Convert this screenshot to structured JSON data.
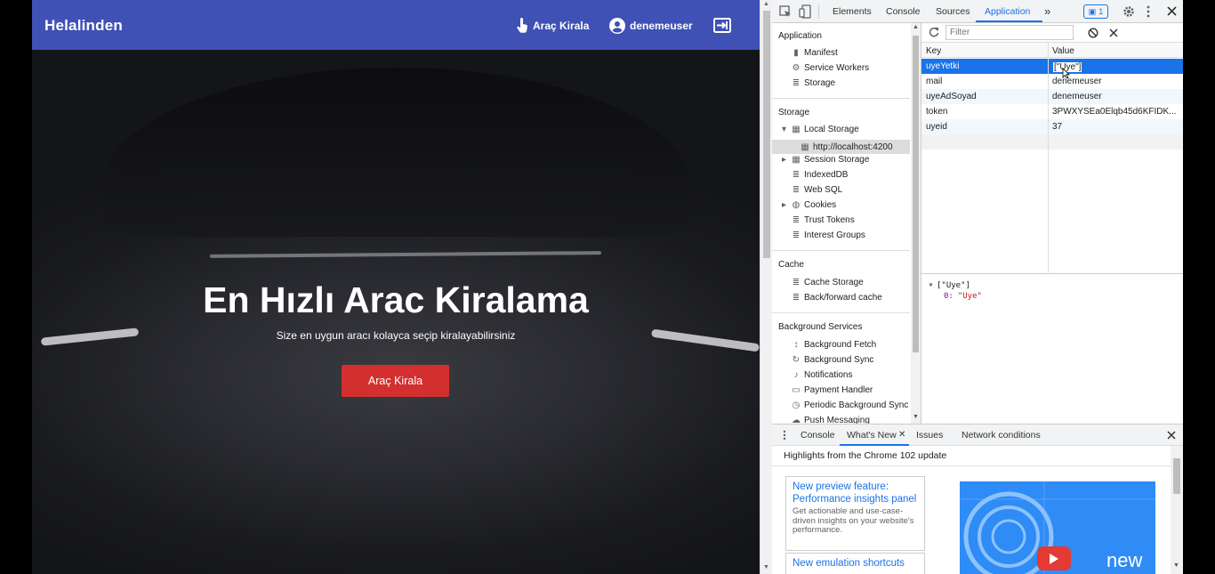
{
  "app": {
    "brand": "Helalinden",
    "nav": {
      "rent_label": "Araç Kirala",
      "user_label": "denemeuser"
    },
    "hero": {
      "title": "En Hızlı Arac Kiralama",
      "subtitle": "Size en uygun aracı kolayca seçip kiralayabilirsiniz",
      "button_label": "Araç Kirala"
    },
    "colors": {
      "navbar": "#3f51b5",
      "button": "#d32f2f"
    }
  },
  "devtools": {
    "tabs": [
      "Elements",
      "Console",
      "Sources",
      "Application"
    ],
    "active_tab": "Application",
    "more_tabs_glyph": "»",
    "issues_badge": "1",
    "sidebar": {
      "application": {
        "title": "Application",
        "items": [
          {
            "icon": "file-icon",
            "label": "Manifest"
          },
          {
            "icon": "gear-icon",
            "label": "Service Workers"
          },
          {
            "icon": "database-icon",
            "label": "Storage"
          }
        ]
      },
      "storage": {
        "title": "Storage",
        "items": [
          {
            "icon": "grid-icon",
            "label": "Local Storage",
            "expanded": true
          },
          {
            "icon": "grid-icon",
            "label": "http://localhost:4200",
            "selected": true
          },
          {
            "icon": "grid-icon",
            "label": "Session Storage",
            "expandable": true
          },
          {
            "icon": "database-icon",
            "label": "IndexedDB"
          },
          {
            "icon": "database-icon",
            "label": "Web SQL"
          },
          {
            "icon": "cookie-icon",
            "label": "Cookies",
            "expandable": true
          },
          {
            "icon": "database-icon",
            "label": "Trust Tokens"
          },
          {
            "icon": "database-icon",
            "label": "Interest Groups"
          }
        ]
      },
      "cache": {
        "title": "Cache",
        "items": [
          {
            "icon": "database-icon",
            "label": "Cache Storage"
          },
          {
            "icon": "database-icon",
            "label": "Back/forward cache"
          }
        ]
      },
      "background": {
        "title": "Background Services",
        "items": [
          {
            "icon": "sync-icon",
            "label": "Background Fetch"
          },
          {
            "icon": "sync-icon",
            "label": "Background Sync"
          },
          {
            "icon": "bell-icon",
            "label": "Notifications"
          },
          {
            "icon": "card-icon",
            "label": "Payment Handler"
          },
          {
            "icon": "clock-icon",
            "label": "Periodic Background Sync"
          },
          {
            "icon": "cloud-icon",
            "label": "Push Messaging"
          }
        ]
      }
    },
    "storage_view": {
      "filter_placeholder": "Filter",
      "columns": {
        "key": "Key",
        "value": "Value"
      },
      "rows": [
        {
          "key": "uyeYetki",
          "value": "[\"Uye\"]"
        },
        {
          "key": "mail",
          "value": "denemeuser"
        },
        {
          "key": "uyeAdSoyad",
          "value": "denemeuser"
        },
        {
          "key": "token",
          "value": "3PWXYSEa0Elqb45d6KFIDK..."
        },
        {
          "key": "uyeid",
          "value": "37"
        }
      ],
      "preview": {
        "root": "[\"Uye\"]",
        "index": "0:",
        "item": "\"Uye\""
      }
    },
    "drawer": {
      "tabs": [
        "Console",
        "What's New",
        "Issues",
        "Network conditions"
      ],
      "active_tab": "What's New",
      "heading": "Highlights from the Chrome 102 update",
      "cards": [
        {
          "title": "New preview feature: Performance insights panel",
          "desc": "Get actionable and use-case-driven insights on your website's performance."
        },
        {
          "title": "New emulation shortcuts",
          "desc": ""
        }
      ],
      "promo_text": "new"
    }
  }
}
